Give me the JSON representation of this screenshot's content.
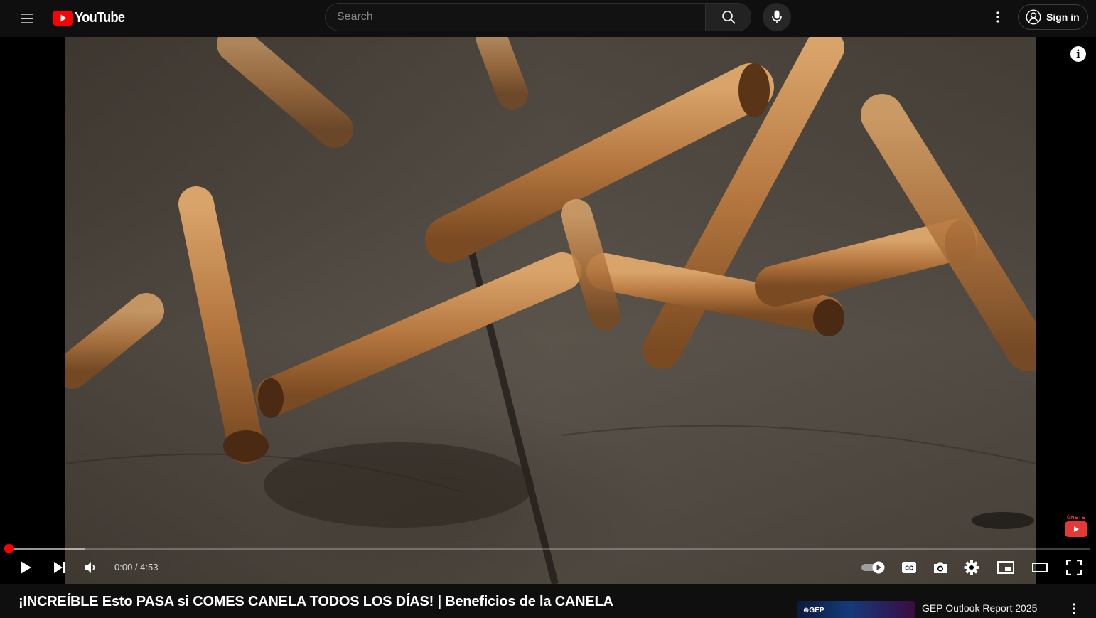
{
  "masthead": {
    "logo_text": "YouTube",
    "search_placeholder": "Search",
    "sign_in_label": "Sign in",
    "icons": [
      "menu-icon",
      "youtube-logo-icon",
      "search-icon",
      "microphone-icon",
      "more-vert-icon",
      "account-circle-icon"
    ]
  },
  "player": {
    "current_time": "0:00",
    "separator": " / ",
    "duration": "4:53",
    "progress_fraction": 0.0,
    "loaded_fraction": 0.07,
    "watermark_text": "ÚNETE",
    "info_symbol": "i",
    "icons": [
      "play-icon",
      "next-icon",
      "volume-icon",
      "autoplay-toggle-icon",
      "captions-icon",
      "screenshot-icon",
      "settings-icon",
      "miniplayer-icon",
      "theater-mode-icon",
      "fullscreen-icon"
    ]
  },
  "video": {
    "title": "¡INCREÍBLE Esto PASA si COMES CANELA TODOS LOS DÍAS! | Beneficios de la CANELA"
  },
  "recommendation": {
    "thumb_logo": "⊕GEP",
    "title": "GEP Outlook Report 2025"
  },
  "colors": {
    "background": "#0f0f0f",
    "accent_red": "#ff0000",
    "search_border": "#303030",
    "text_primary": "#ffffff"
  }
}
